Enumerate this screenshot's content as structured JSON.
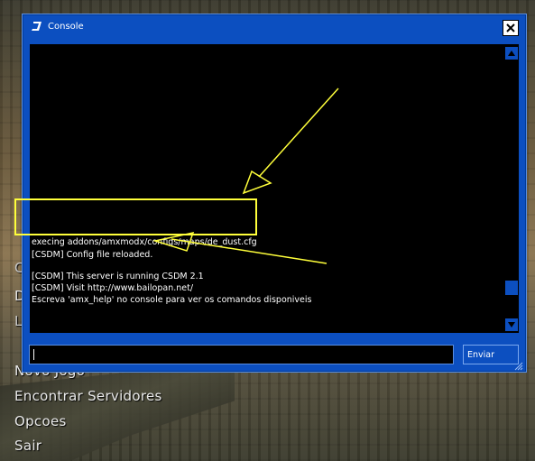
{
  "window": {
    "title": "Console"
  },
  "output_lines": [
    "execing addons/amxmodx/configs/maps/de_dust.cfg",
    "[CSDM] Config file reloaded.",
    "[CSDM] This server is running CSDM 2.1",
    "[CSDM] Visit http://www.bailopan.net/",
    "Escreva 'amx_help' no console para ver os comandos disponiveis"
  ],
  "input": {
    "value": ""
  },
  "send_button": {
    "label": "Enviar"
  },
  "main_menu": [
    {
      "label": "C"
    },
    {
      "label": "De"
    },
    {
      "label": "Li"
    },
    {
      "label": "Novo Jogo"
    },
    {
      "label": "Encontrar Servidores"
    },
    {
      "label": "Opcoes"
    },
    {
      "label": "Sair"
    }
  ],
  "colors": {
    "window_blue": "#0c4fc0",
    "annotation_yellow": "#ffff3a"
  },
  "icons": [
    "steam-logo-icon",
    "close-icon",
    "scroll-up-icon",
    "scroll-down-icon",
    "resize-grip-icon"
  ]
}
